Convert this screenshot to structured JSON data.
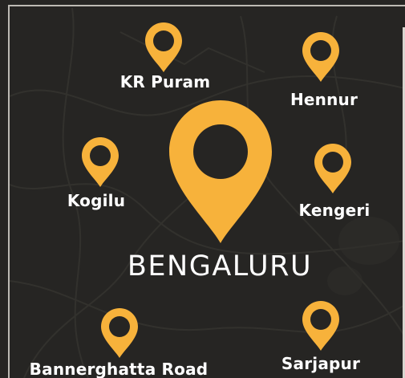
{
  "map": {
    "city": "BENGALURU",
    "accent_color": "#f7b23b",
    "background_color": "#262523",
    "pin_icon": "map-pin-icon",
    "locations": [
      {
        "name": "KR Puram"
      },
      {
        "name": "Hennur"
      },
      {
        "name": "Kogilu"
      },
      {
        "name": "Kengeri"
      },
      {
        "name": "Bannerghatta Road"
      },
      {
        "name": "Sarjapur"
      }
    ]
  }
}
